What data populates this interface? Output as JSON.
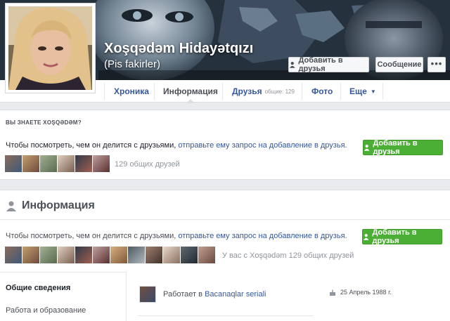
{
  "profile": {
    "name": "Xoşqədəm Hidayətqızı",
    "nickname": "(Pis fakirler)"
  },
  "actions": {
    "add_friend": "Добавить в друзья",
    "message": "Сообщение",
    "more": "•••"
  },
  "tabs": [
    {
      "label": "Хроника"
    },
    {
      "label": "Информация"
    },
    {
      "label": "Друзья",
      "count": "общие: 129"
    },
    {
      "label": "Фото"
    },
    {
      "label": "Еще"
    }
  ],
  "know": {
    "heading": "ВЫ ЗНАЕТЕ XOŞQƏDƏM?",
    "prompt_text": "Чтобы посмотреть, чем он делится с друзьями,",
    "prompt_link": "отправьте ему запрос на добавление в друзья.",
    "add_button": "Добавить в друзья",
    "mutual": "129 общих друзей"
  },
  "info": {
    "title": "Информация",
    "prompt_text": "Чтобы посмотреть, чем он делится с друзьями,",
    "prompt_link": "отправьте ему запрос на добавление в друзья.",
    "add_button": "Добавить в друзья",
    "mutual": "У вас с Xoşqədəm 129 общих друзей",
    "nav": [
      "Общие сведения",
      "Работа и образование"
    ],
    "work_prefix": "Работает в",
    "work_link": "Bacanaqlar seriali",
    "birthday": "25 Апрель 1988 г."
  },
  "colors": {
    "link": "#365899",
    "green": "#4caf35",
    "background": "#e9ebee"
  },
  "icons": [
    "add-friend-icon",
    "caret-down-icon",
    "person-icon",
    "cake-icon"
  ]
}
